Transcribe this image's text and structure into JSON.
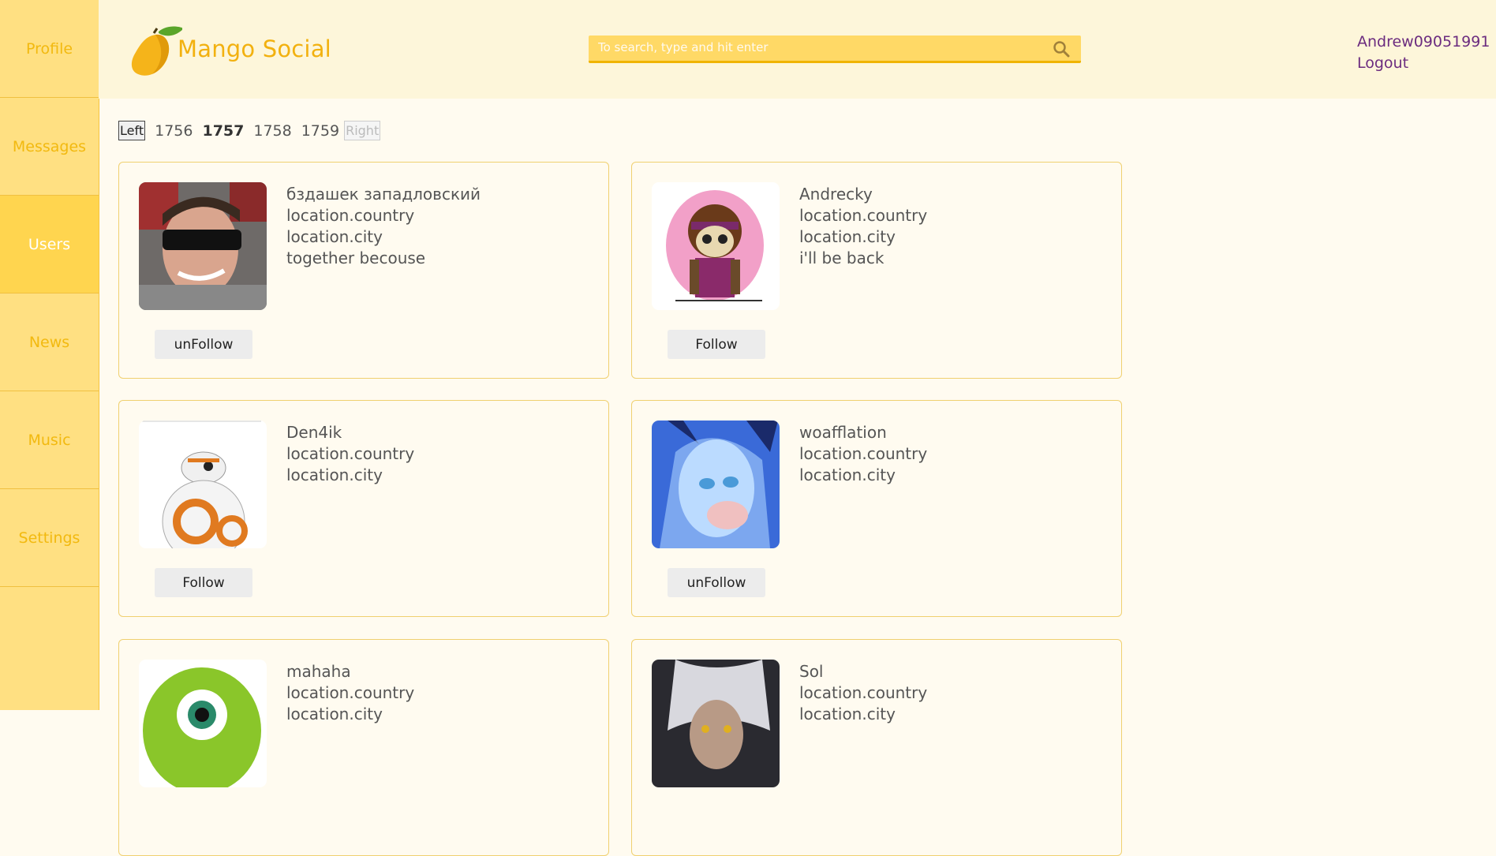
{
  "sidebar": {
    "items": [
      {
        "label": "Profile"
      },
      {
        "label": "Messages"
      },
      {
        "label": "Users"
      },
      {
        "label": "News"
      },
      {
        "label": "Music"
      },
      {
        "label": "Settings"
      }
    ],
    "active": "Users"
  },
  "header": {
    "brand": "Mango Social",
    "logo_icon": "mango-logo-icon",
    "search_placeholder": "To search, type and hit enter",
    "username": "Andrew09051991",
    "logout": "Logout"
  },
  "pagination": {
    "left": "Left",
    "pages": [
      "1756",
      "1757",
      "1758",
      "1759"
    ],
    "current": "1757",
    "right": "Right"
  },
  "users": [
    {
      "name": "бздашек западловский",
      "country": "location.country",
      "city": "location.city",
      "status": "together becouse",
      "button": "unFollow"
    },
    {
      "name": "Andrecky",
      "country": "location.country",
      "city": "location.city",
      "status": "i'll be back",
      "button": "Follow"
    },
    {
      "name": "Den4ik",
      "country": "location.country",
      "city": "location.city",
      "status": "",
      "button": "Follow"
    },
    {
      "name": "woafflation",
      "country": "location.country",
      "city": "location.city",
      "status": "",
      "button": "unFollow"
    },
    {
      "name": "mahaha",
      "country": "location.country",
      "city": "location.city",
      "status": "",
      "button": ""
    },
    {
      "name": "Sol",
      "country": "location.country",
      "city": "location.city",
      "status": "",
      "button": ""
    }
  ],
  "colors": {
    "sidebar": "#ffe082",
    "sidebar_active": "#ffd54f",
    "accent": "#f2b10f",
    "header_bg": "#fdf6da",
    "username": "#6b2c7f"
  }
}
